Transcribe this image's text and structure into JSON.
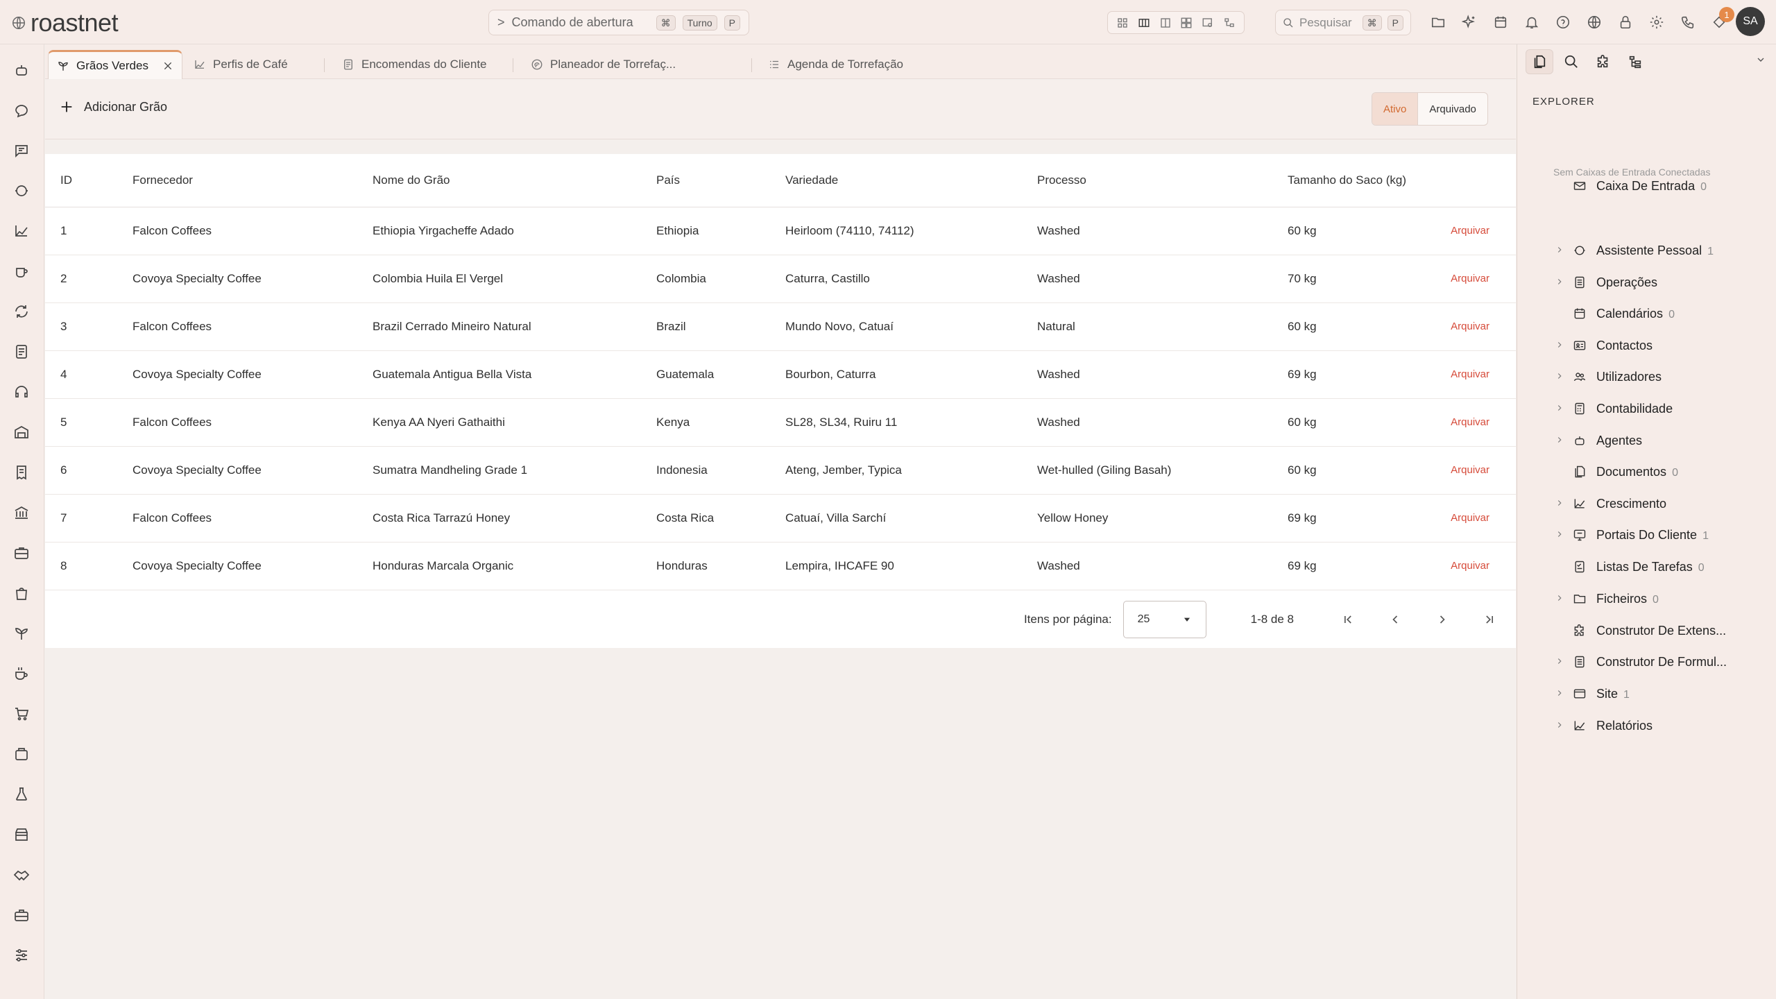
{
  "app": {
    "brand": "roastnet",
    "command": {
      "prefix": ">",
      "label": "Comando de abertura",
      "keys": [
        "⌘",
        "Turno",
        "P"
      ]
    },
    "search": {
      "label": "Pesquisar",
      "keys": [
        "⌘",
        "P"
      ]
    },
    "notifications_count": "1",
    "user_initials": "SA",
    "accent_color": "#e09a6b",
    "archive_color": "#d64b3a"
  },
  "tabs": [
    {
      "label": "Grãos Verdes",
      "icon": "sprout-icon",
      "active": true
    },
    {
      "label": "Perfis de Café",
      "icon": "chart-line-icon",
      "active": false
    },
    {
      "label": "Encomendas do Cliente",
      "icon": "document-icon",
      "active": false
    },
    {
      "label": "Planeador de Torrefaç...",
      "icon": "fingerprint-icon",
      "active": false
    },
    {
      "label": "Agenda de Torrefação",
      "icon": "list-icon",
      "active": false
    }
  ],
  "toolbar": {
    "add_label": "Adicionar Grão",
    "filter_active": "Ativo",
    "filter_archived": "Arquivado"
  },
  "table": {
    "columns": [
      "ID",
      "Fornecedor",
      "Nome do Grão",
      "País",
      "Variedade",
      "Processo",
      "Tamanho do Saco (kg)"
    ],
    "action_label": "Arquivar",
    "rows": [
      {
        "id": "1",
        "supplier": "Falcon Coffees",
        "name": "Ethiopia Yirgacheffe Adado",
        "country": "Ethiopia",
        "variety": "Heirloom (74110, 74112)",
        "process": "Washed",
        "size": "60 kg"
      },
      {
        "id": "2",
        "supplier": "Covoya Specialty Coffee",
        "name": "Colombia Huila El Vergel",
        "country": "Colombia",
        "variety": "Caturra, Castillo",
        "process": "Washed",
        "size": "70 kg"
      },
      {
        "id": "3",
        "supplier": "Falcon Coffees",
        "name": "Brazil Cerrado Mineiro Natural",
        "country": "Brazil",
        "variety": "Mundo Novo, Catuaí",
        "process": "Natural",
        "size": "60 kg"
      },
      {
        "id": "4",
        "supplier": "Covoya Specialty Coffee",
        "name": "Guatemala Antigua Bella Vista",
        "country": "Guatemala",
        "variety": "Bourbon, Caturra",
        "process": "Washed",
        "size": "69 kg"
      },
      {
        "id": "5",
        "supplier": "Falcon Coffees",
        "name": "Kenya AA Nyeri Gathaithi",
        "country": "Kenya",
        "variety": "SL28, SL34, Ruiru 11",
        "process": "Washed",
        "size": "60 kg"
      },
      {
        "id": "6",
        "supplier": "Covoya Specialty Coffee",
        "name": "Sumatra Mandheling Grade 1",
        "country": "Indonesia",
        "variety": "Ateng, Jember, Typica",
        "process": "Wet-hulled (Giling Basah)",
        "size": "60 kg"
      },
      {
        "id": "7",
        "supplier": "Falcon Coffees",
        "name": "Costa Rica Tarrazú Honey",
        "country": "Costa Rica",
        "variety": "Catuaí, Villa Sarchí",
        "process": "Yellow Honey",
        "size": "69 kg"
      },
      {
        "id": "8",
        "supplier": "Covoya Specialty Coffee",
        "name": "Honduras Marcala Organic",
        "country": "Honduras",
        "variety": "Lempira, IHCAFE 90",
        "process": "Washed",
        "size": "69 kg"
      }
    ]
  },
  "pagination": {
    "per_page_label": "Itens por página:",
    "per_page_value": "25",
    "range": "1-8 de 8"
  },
  "explorer": {
    "title": "EXPLORER",
    "no_inbox_note": "Sem Caixas de Entrada Conectadas",
    "items": [
      {
        "label": "Caixa De Entrada",
        "count": "0",
        "icon": "mail-icon",
        "expandable": false
      },
      {
        "label": "Assistente Pessoal",
        "count": "1",
        "icon": "assistant-icon",
        "expandable": true
      },
      {
        "label": "Operações",
        "count": "",
        "icon": "operations-icon",
        "expandable": true
      },
      {
        "label": "Calendários",
        "count": "0",
        "icon": "calendar-icon",
        "expandable": false
      },
      {
        "label": "Contactos",
        "count": "",
        "icon": "contact-card-icon",
        "expandable": true
      },
      {
        "label": "Utilizadores",
        "count": "",
        "icon": "users-icon",
        "expandable": true
      },
      {
        "label": "Contabilidade",
        "count": "",
        "icon": "calculator-icon",
        "expandable": true
      },
      {
        "label": "Agentes",
        "count": "",
        "icon": "robot-icon",
        "expandable": true
      },
      {
        "label": "Documentos",
        "count": "0",
        "icon": "documents-icon",
        "expandable": false
      },
      {
        "label": "Crescimento",
        "count": "",
        "icon": "growth-chart-icon",
        "expandable": true
      },
      {
        "label": "Portais Do Cliente",
        "count": "1",
        "icon": "portal-icon",
        "expandable": true
      },
      {
        "label": "Listas De Tarefas",
        "count": "0",
        "icon": "tasks-icon",
        "expandable": false
      },
      {
        "label": "Ficheiros",
        "count": "0",
        "icon": "folder-icon",
        "expandable": true
      },
      {
        "label": "Construtor De Extens...",
        "count": "",
        "icon": "puzzle-icon",
        "expandable": false
      },
      {
        "label": "Construtor De Formul...",
        "count": "",
        "icon": "form-icon",
        "expandable": true
      },
      {
        "label": "Site",
        "count": "1",
        "icon": "browser-icon",
        "expandable": true
      },
      {
        "label": "Relatórios",
        "count": "",
        "icon": "report-chart-icon",
        "expandable": true
      }
    ]
  }
}
